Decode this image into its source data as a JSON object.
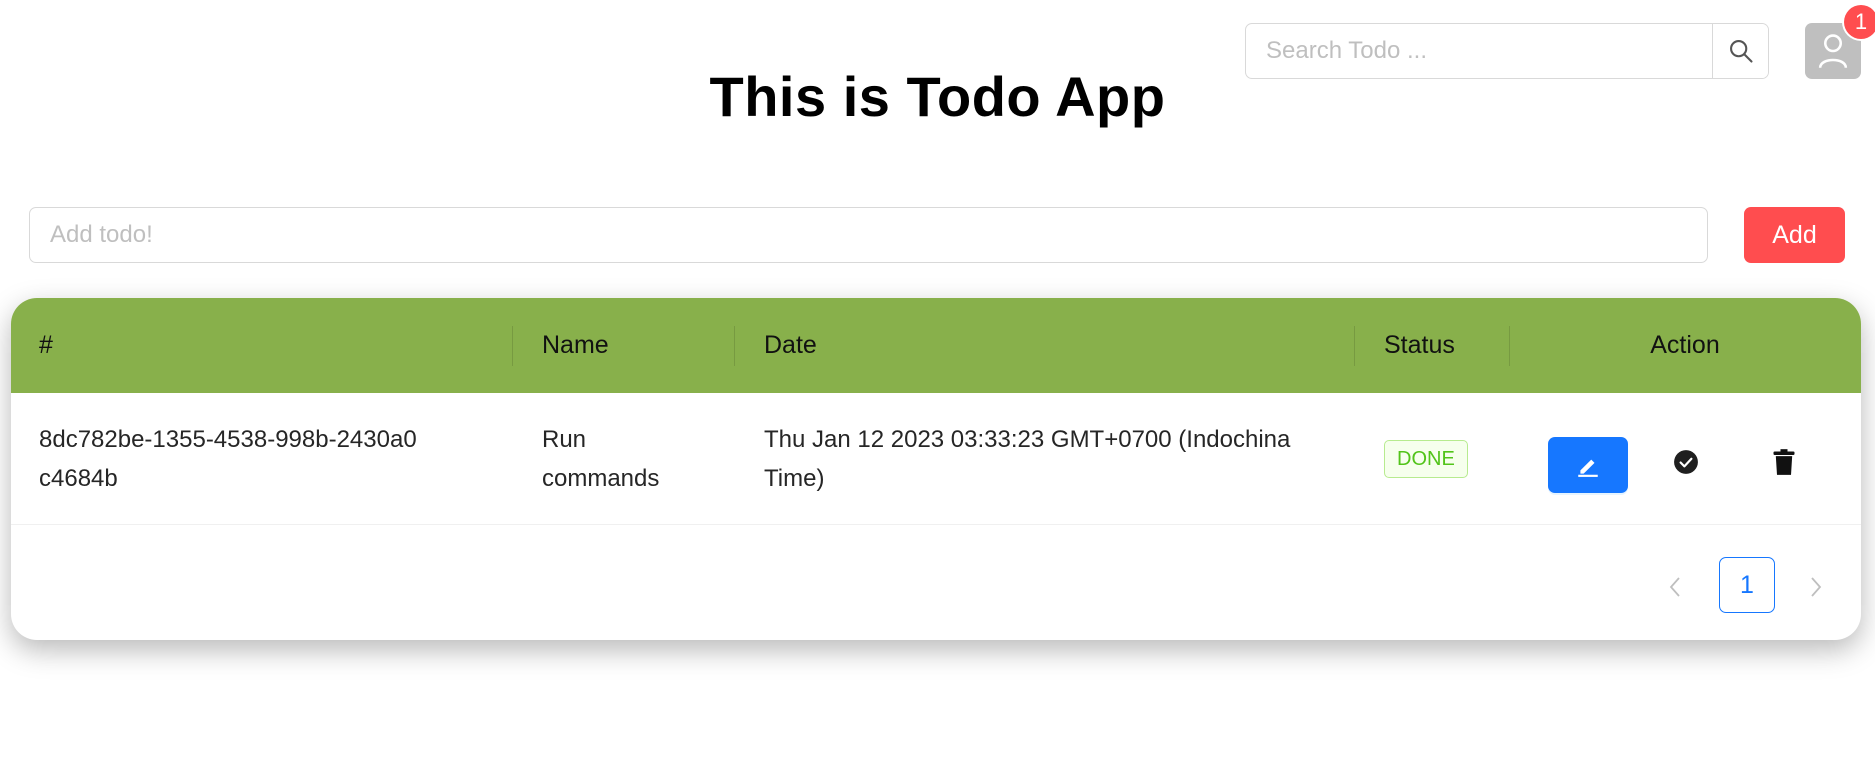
{
  "header": {
    "title": "This is Todo App",
    "search": {
      "placeholder": "Search Todo ...",
      "value": ""
    },
    "notification_count": "1"
  },
  "add_form": {
    "placeholder": "Add todo!",
    "value": "",
    "button_label": "Add"
  },
  "table": {
    "header_color": "#88b04b",
    "columns": [
      "#",
      "Name",
      "Date",
      "Status",
      "Action"
    ],
    "rows": [
      {
        "id": "8dc782be-1355-4538-998b-2430a0c4684b",
        "name": "Run commands",
        "date": "Thu Jan 12 2023 03:33:23 GMT+0700 (Indochina Time)",
        "status": "DONE",
        "actions": [
          "edit-icon",
          "check-circle-icon",
          "trash-icon"
        ]
      }
    ]
  },
  "pagination": {
    "current_page": "1",
    "prev_icon": "chevron-left-icon",
    "next_icon": "chevron-right-icon"
  },
  "colors": {
    "accent_blue": "#1677ff",
    "danger_red": "#ff4d4f",
    "success_green": "#52c41a"
  }
}
